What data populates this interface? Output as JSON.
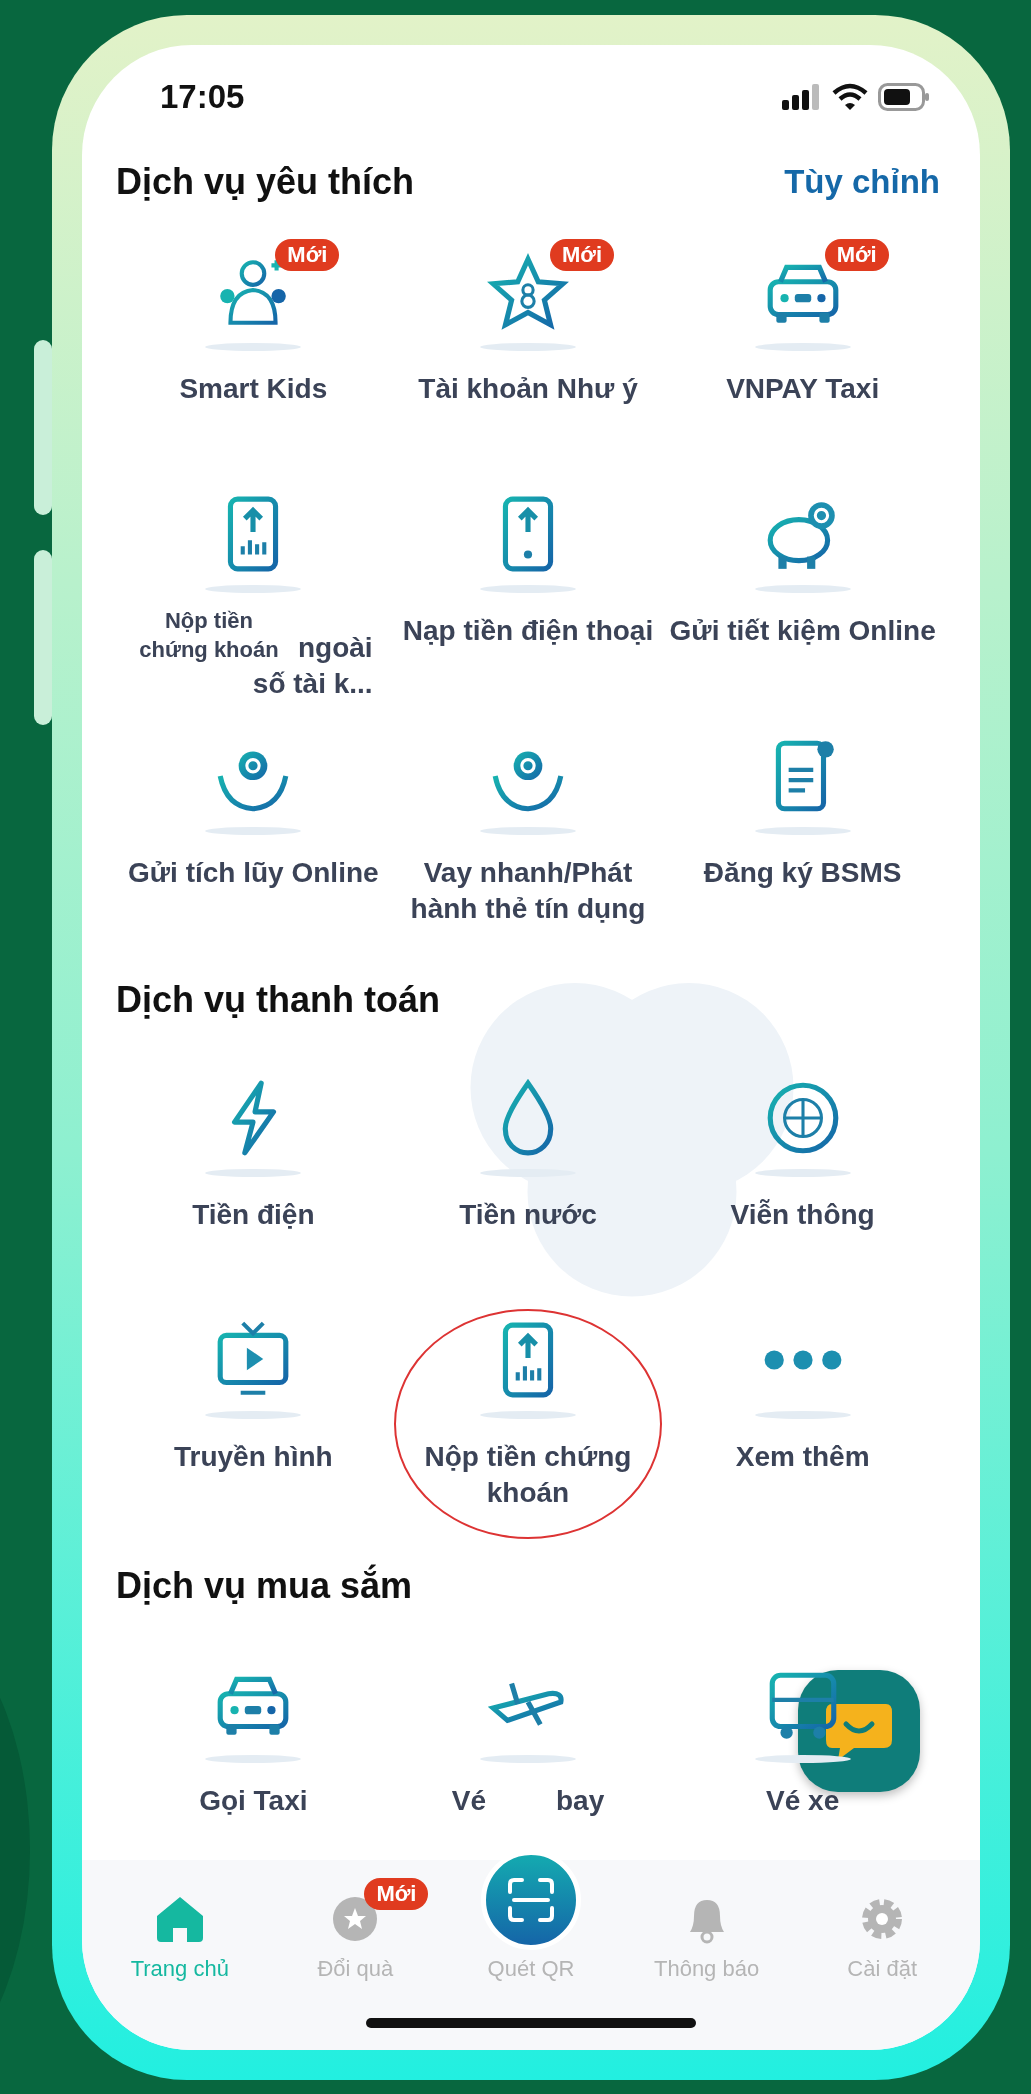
{
  "status_bar": {
    "time": "17:05"
  },
  "sections": [
    {
      "title": "Dịch vụ yêu thích",
      "action": "Tùy chỉnh",
      "items": [
        {
          "kind": "normal",
          "label": "Smart Kids",
          "badge": "Mới"
        },
        {
          "kind": "normal",
          "label": "Tài khoản Như ý",
          "badge": "Mới"
        },
        {
          "kind": "normal",
          "label": "VNPAY Taxi",
          "badge": "Mới"
        },
        {
          "kind": "overlay",
          "label": "Nộp tiền chứng khoán",
          "under_texts": [
            "ngoài",
            "số tài k..."
          ]
        },
        {
          "kind": "normal",
          "label": "Nạp tiền điện thoại"
        },
        {
          "kind": "normal",
          "label": "Gửi tiết kiệm Online"
        },
        {
          "kind": "normal",
          "label": "Gửi tích lũy Online"
        },
        {
          "kind": "normal",
          "label": "Vay nhanh/Phát hành thẻ tín dụng"
        },
        {
          "kind": "normal",
          "label": "Đăng ký BSMS"
        }
      ]
    },
    {
      "title": "Dịch vụ thanh toán",
      "items": [
        {
          "kind": "normal",
          "label": "Tiền điện"
        },
        {
          "kind": "normal",
          "label": "Tiền nước"
        },
        {
          "kind": "normal",
          "label": "Viễn thông"
        },
        {
          "kind": "normal",
          "label": "Truyền hình"
        },
        {
          "kind": "circled",
          "label": "Nộp tiền chứng khoán"
        },
        {
          "kind": "normal",
          "label": "Xem thêm"
        }
      ]
    },
    {
      "title": "Dịch vụ mua sắm",
      "items": [
        {
          "kind": "normal",
          "label": "Gọi Taxi"
        },
        {
          "kind": "split",
          "parts": [
            "Vé",
            "bay"
          ]
        },
        {
          "kind": "normal",
          "label": "Vé xe"
        }
      ]
    }
  ],
  "nav": [
    {
      "kind": "tab",
      "label": "Trang chủ",
      "selected": true
    },
    {
      "kind": "tab",
      "label": "Đổi quà",
      "selected": false,
      "badge": "Mới"
    },
    {
      "kind": "scan",
      "label": "Quét QR",
      "selected": false
    },
    {
      "kind": "tab",
      "label": "Thông báo",
      "selected": false
    },
    {
      "kind": "tab",
      "label": "Cài đặt",
      "selected": false
    }
  ]
}
